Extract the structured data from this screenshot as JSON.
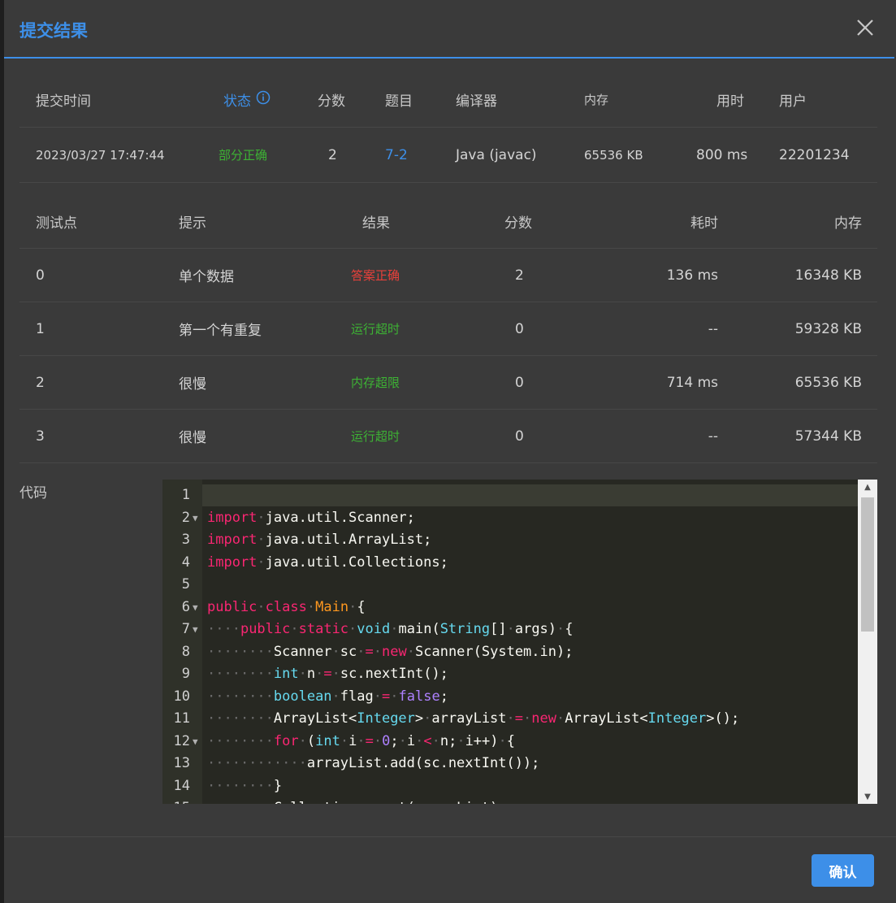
{
  "dialog": {
    "title": "提交结果",
    "confirm_label": "确认"
  },
  "summary": {
    "headers": {
      "time": "提交时间",
      "status": "状态",
      "score": "分数",
      "problem": "题目",
      "compiler": "编译器",
      "memory": "内存",
      "duration": "用时",
      "user": "用户"
    },
    "row": {
      "time": "2023/03/27 17:47:44",
      "status": "部分正确",
      "score": "2",
      "problem": "7-2",
      "compiler": "Java (javac)",
      "memory": "65536 KB",
      "duration": "800 ms",
      "user": "22201234"
    }
  },
  "tests": {
    "headers": {
      "id": "测试点",
      "hint": "提示",
      "result": "结果",
      "score": "分数",
      "time": "耗时",
      "memory": "内存"
    },
    "rows": [
      {
        "id": "0",
        "hint": "单个数据",
        "result": "答案正确",
        "score": "2",
        "time": "136 ms",
        "memory": "16348 KB",
        "result_color": "#e8403a"
      },
      {
        "id": "1",
        "hint": "第一个有重复",
        "result": "运行超时",
        "score": "0",
        "time": "--",
        "memory": "59328 KB",
        "result_color": "#3db234"
      },
      {
        "id": "2",
        "hint": "很慢",
        "result": "内存超限",
        "score": "0",
        "time": "714 ms",
        "memory": "65536 KB",
        "result_color": "#3db234"
      },
      {
        "id": "3",
        "hint": "很慢",
        "result": "运行超时",
        "score": "0",
        "time": "--",
        "memory": "57344 KB",
        "result_color": "#3db234"
      }
    ]
  },
  "code": {
    "label": "代码",
    "lines": [
      "",
      "import java.util.Scanner;",
      "import java.util.ArrayList;",
      "import java.util.Collections;",
      "",
      "public class Main {",
      "    public static void main(String[] args) {",
      "        Scanner sc = new Scanner(System.in);",
      "        int n = sc.nextInt();",
      "        boolean flag = false;",
      "        ArrayList<Integer> arrayList = new ArrayList<Integer>();",
      "        for (int i = 0; i < n; i++) {",
      "            arrayList.add(sc.nextInt());",
      "        }",
      "        Collections.sort(arrayList);"
    ],
    "foldable_lines": [
      2,
      6,
      7,
      12
    ]
  },
  "colors": {
    "accent": "#3d8fe8",
    "success_green": "#3db234",
    "error_red": "#e8403a"
  },
  "icons": {
    "close": "close-icon",
    "info": "info-circle-icon"
  }
}
